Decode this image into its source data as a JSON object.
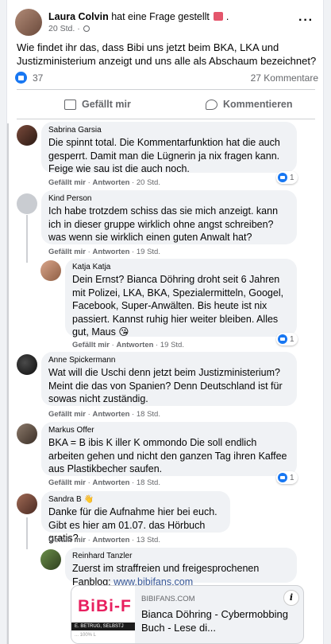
{
  "post": {
    "author": "Laura Colvin",
    "action": "hat eine Frage gestellt",
    "time": "20 Std. ·",
    "text": "Wie findet ihr das, dass Bibi uns jetzt beim BKA, LKA und Justizministerium anzeigt und uns alle als Abschaum bezeichnet?",
    "likes": "37",
    "comments_count": "27 Kommentare",
    "more": "···"
  },
  "actions": {
    "like": "Gefällt mir",
    "comment": "Kommentieren"
  },
  "comment_actions": {
    "like": "Gefällt mir",
    "reply": "Antworten"
  },
  "comments": [
    {
      "name": "Sabrina Garsia",
      "text": "Die spinnt total. Die Kommentarfunktion hat die auch gesperrt. Damit man die Lügnerin ja nix fragen kann. Feige wie sau ist die auch noch.",
      "time": "20 Std.",
      "reactions": "1"
    },
    {
      "name": "Kind Person",
      "text": "Ich habe trotzdem schiss das sie mich anzeigt. kann ich in dieser gruppe wirklich ohne angst schreiben? was wenn sie wirklich einen guten Anwalt hat?",
      "time": "19 Std."
    },
    {
      "name": "Katja Katja",
      "text": "Dein Ernst? Bianca Döhring droht seit 6 Jahren mit Polizei, LKA, BKA, Spezialermitteln, Googel, Facebook, Super-Anwälten. Bis heute ist nix passiert. Kannst ruhig hier weiter bleiben. Alles gut, Maus 😘",
      "time": "19 Std.",
      "reactions": "1"
    },
    {
      "name": "Anne Spickermann",
      "text": "Wat will die Uschi denn jetzt beim Justizministerium? Meint die das von Spanien? Denn Deutschland ist für sowas nicht zuständig.",
      "time": "18 Std."
    },
    {
      "name": "Markus Offer",
      "text": "BKA = B ibis K iller K ommondo Die soll endlich arbeiten gehen und nicht den ganzen Tag ihren Kaffee aus Plastikbecher saufen.",
      "time": "18 Std.",
      "reactions": "1"
    },
    {
      "name": "Sandra B",
      "name_emoji": "👋",
      "text": "Danke für die Aufnahme hier bei euch. Gibt es hier am 01.07. das Hörbuch gratis?",
      "time": "13 Std."
    },
    {
      "name": "Reinhard Tanzler",
      "text": "Zuerst im straffreien und freigesprochenen Fanblog: ",
      "link": "www.bibifans.com"
    }
  ],
  "preview": {
    "logo_text": "BiBi-F",
    "strip_text": "E. BETRUG, SELBSTJ",
    "strip2_text": "...  100% L",
    "domain": "BIBIFANS.COM",
    "title": "Bianca Döhring - Cybermobbing Buch - Lese di...",
    "info": "i"
  },
  "colors": {
    "accent": "#1877f2",
    "bubble": "#f0f2f5",
    "meta": "#65676b",
    "link": "#385898",
    "brand": "#e8205f"
  }
}
